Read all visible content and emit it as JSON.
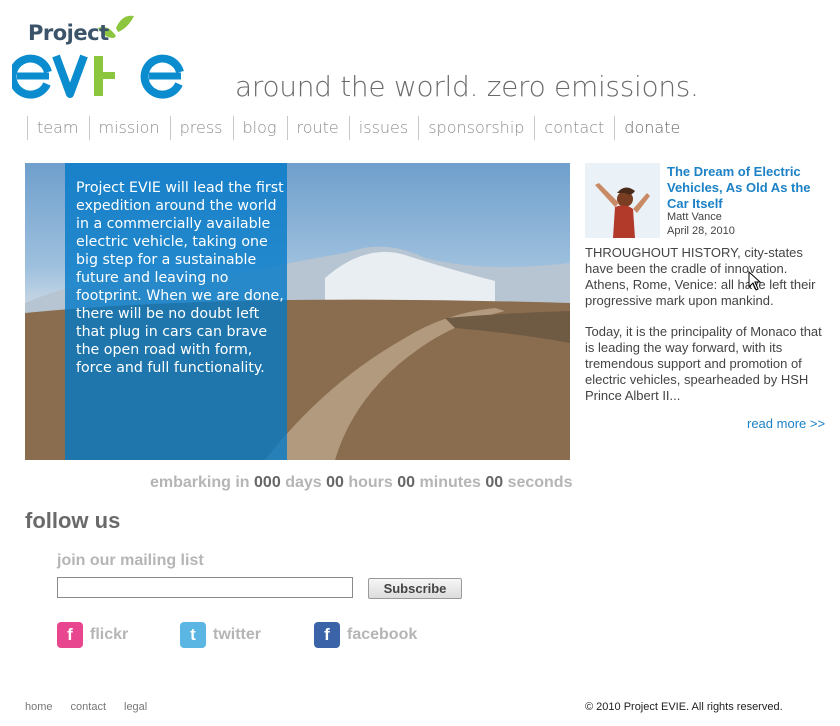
{
  "logo": {
    "project": "Project",
    "name": "EVIE"
  },
  "tagline": "around the world. zero emissions.",
  "nav": [
    "team",
    "mission",
    "press",
    "blog",
    "route",
    "issues",
    "sponsorship",
    "contact",
    "donate"
  ],
  "hero": {
    "text": "Project EVIE will lead the first expedition around the world in a commercially available electric vehicle, taking one big step for a sustainable future and leaving no footprint. When we are done, there will be no doubt left that plug in cars can brave the open road with form, force and full functionality."
  },
  "countdown": {
    "prefix": "embarking in",
    "days": "000",
    "days_label": "days",
    "hours": "00",
    "hours_label": "hours",
    "minutes": "00",
    "minutes_label": "minutes",
    "seconds": "00",
    "seconds_label": "seconds"
  },
  "article": {
    "title": "The Dream of Electric Vehicles, As Old As the Car Itself",
    "author": "Matt Vance",
    "date": "April 28, 2010",
    "para1": "THROUGHOUT HISTORY, city-states have been the cradle of innovation. Athens, Rome, Venice: all have left their progressive mark upon mankind.",
    "para2": "Today, it is the principality of Monaco that is leading the way forward, with its tremendous support and promotion of electric vehicles, spearheaded by HSH Prince Albert II...",
    "read_more": "read more >>"
  },
  "follow": {
    "heading": "follow us",
    "mailing_label": "join our mailing list",
    "email_value": "",
    "subscribe_label": "Subscribe"
  },
  "social": [
    {
      "label": "flickr",
      "icon": "flickr-icon",
      "color": "#e8468f"
    },
    {
      "label": "twitter",
      "icon": "twitter-icon",
      "color": "#5cb6e4"
    },
    {
      "label": "facebook",
      "icon": "facebook-icon",
      "color": "#3b63a8"
    }
  ],
  "footer": {
    "links": [
      "home",
      "contact",
      "legal"
    ],
    "copyright": "© 2010 Project EVIE. All rights reserved."
  },
  "colors": {
    "accent_blue": "#1c81c6",
    "logo_green": "#8cc63f",
    "logo_blue": "#0a8ccf"
  }
}
